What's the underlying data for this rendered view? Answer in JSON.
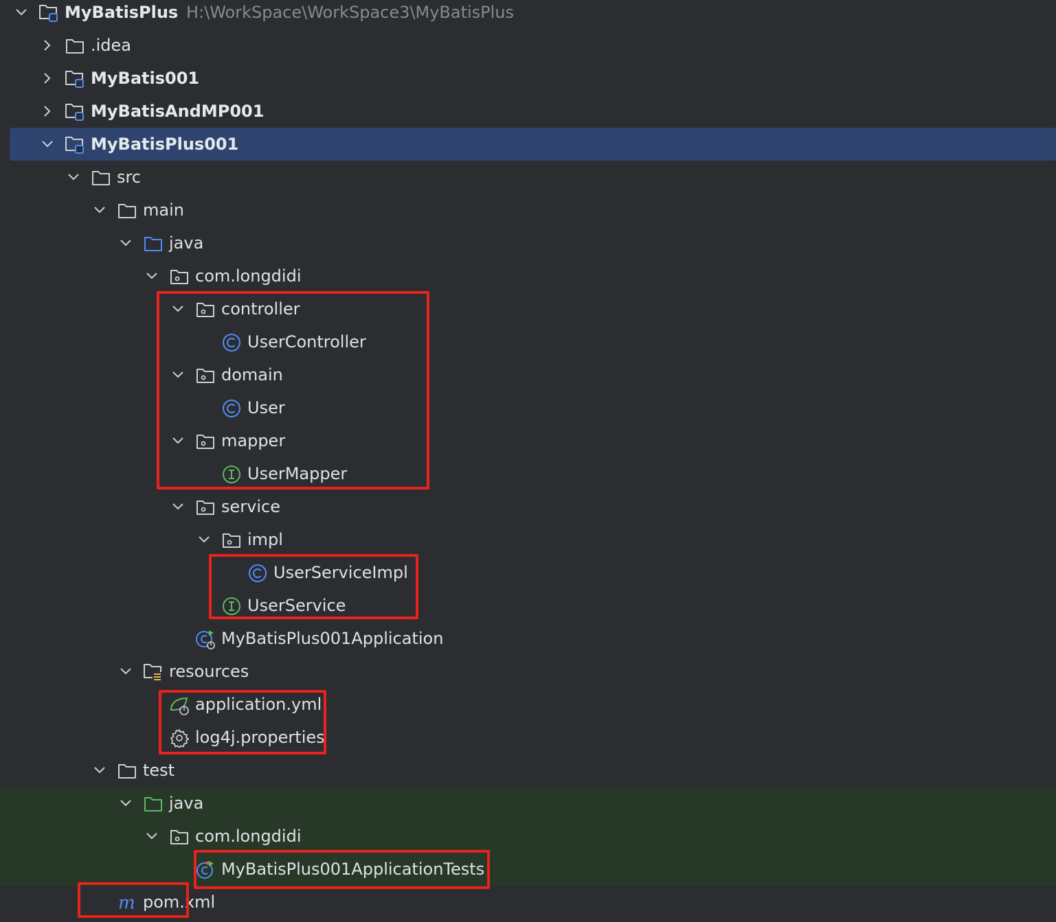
{
  "tree": [
    {
      "label": "MyBatisPlus",
      "path": "H:\\WorkSpace\\WorkSpace3\\MyBatisPlus",
      "icon": "module-folder-icon",
      "chevron": "down",
      "bold": true,
      "depth": 0
    },
    {
      "label": ".idea",
      "icon": "folder-icon",
      "chevron": "right",
      "depth": 1
    },
    {
      "label": "MyBatis001",
      "icon": "module-folder-icon",
      "chevron": "right",
      "bold": true,
      "depth": 1
    },
    {
      "label": "MyBatisAndMP001",
      "icon": "module-folder-icon",
      "chevron": "right",
      "bold": true,
      "depth": 1
    },
    {
      "label": "MyBatisPlus001",
      "icon": "module-folder-icon",
      "chevron": "down",
      "bold": true,
      "depth": 1,
      "selected": true
    },
    {
      "label": "src",
      "icon": "folder-icon",
      "chevron": "down",
      "depth": 2
    },
    {
      "label": "main",
      "icon": "folder-icon",
      "chevron": "down",
      "depth": 3
    },
    {
      "label": "java",
      "icon": "source-folder-icon",
      "chevron": "down",
      "depth": 4
    },
    {
      "label": "com.longdidi",
      "icon": "package-icon",
      "chevron": "down",
      "depth": 5
    },
    {
      "label": "controller",
      "icon": "package-icon",
      "chevron": "down",
      "depth": 6
    },
    {
      "label": "UserController",
      "icon": "class-icon",
      "depth": 7
    },
    {
      "label": "domain",
      "icon": "package-icon",
      "chevron": "down",
      "depth": 6
    },
    {
      "label": "User",
      "icon": "class-icon",
      "depth": 7
    },
    {
      "label": "mapper",
      "icon": "package-icon",
      "chevron": "down",
      "depth": 6
    },
    {
      "label": "UserMapper",
      "icon": "interface-icon",
      "depth": 7
    },
    {
      "label": "service",
      "icon": "package-icon",
      "chevron": "down",
      "depth": 6
    },
    {
      "label": "impl",
      "icon": "package-icon",
      "chevron": "down",
      "depth": 7
    },
    {
      "label": "UserServiceImpl",
      "icon": "class-icon",
      "depth": 8
    },
    {
      "label": "UserService",
      "icon": "interface-icon",
      "depth": 7
    },
    {
      "label": "MyBatisPlus001Application",
      "icon": "spring-boot-class-icon",
      "depth": 6
    },
    {
      "label": "resources",
      "icon": "resources-folder-icon",
      "chevron": "down",
      "depth": 4
    },
    {
      "label": "application.yml",
      "icon": "spring-config-icon",
      "depth": 5
    },
    {
      "label": "log4j.properties",
      "icon": "gear-icon",
      "depth": 5
    },
    {
      "label": "test",
      "icon": "folder-icon",
      "chevron": "down",
      "depth": 3
    },
    {
      "label": "java",
      "icon": "test-source-folder-icon",
      "chevron": "down",
      "depth": 4,
      "test": true
    },
    {
      "label": "com.longdidi",
      "icon": "package-icon",
      "chevron": "down",
      "depth": 5,
      "test": true
    },
    {
      "label": "MyBatisPlus001ApplicationTests",
      "icon": "test-class-icon",
      "depth": 6,
      "test": true
    },
    {
      "label": "pom.xml",
      "icon": "maven-icon",
      "depth": 3
    }
  ],
  "colors": {
    "background": "#2b2d30",
    "selection": "#2e436e",
    "test_background": "#273828",
    "annotation_red": "#e8231b",
    "class_blue": "#548af7",
    "interface_green": "#5fb865",
    "path_gray": "#868a91"
  }
}
